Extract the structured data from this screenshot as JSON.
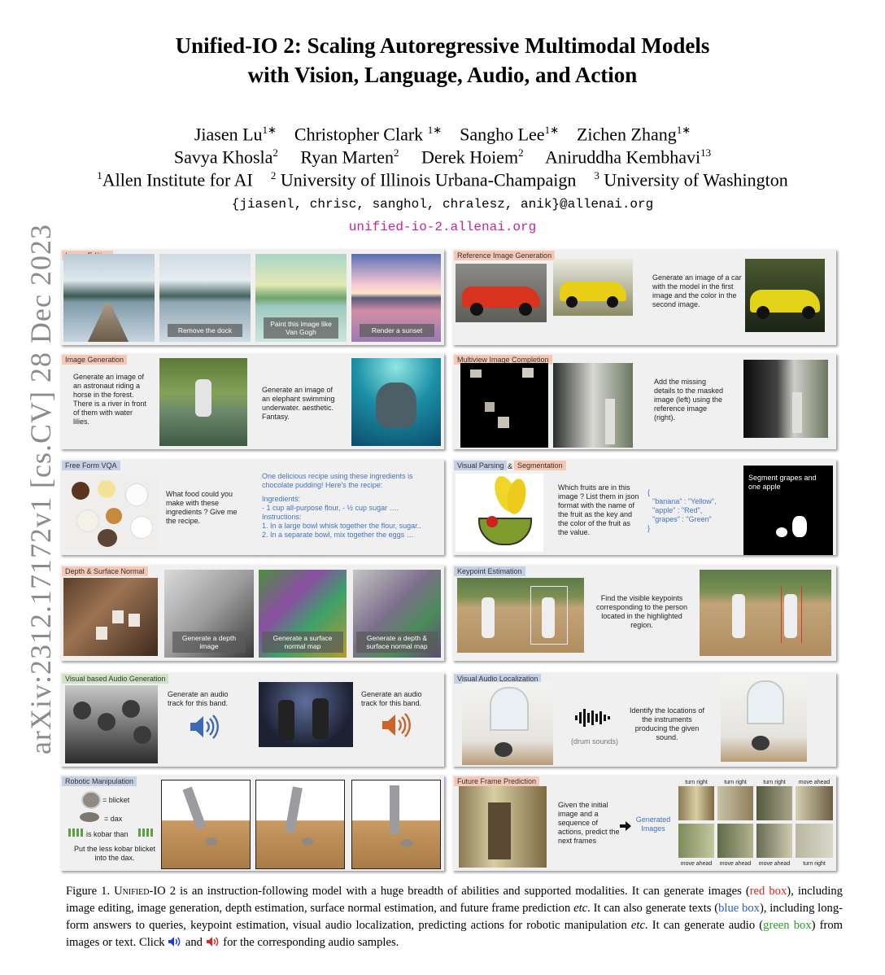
{
  "sidebar_stamp": "arXiv:2312.17172v1  [cs.CV]  28 Dec 2023",
  "title": {
    "line1": "Unified-IO 2: Scaling Autoregressive Multimodal Models",
    "line2": "with Vision, Language, Audio, and Action"
  },
  "authors": {
    "a1": "Jiasen Lu",
    "a2": "Christopher Clark",
    "a3": "Sangho Lee",
    "a4": "Zichen Zhang",
    "a5": "Savya Khosla",
    "a6": "Ryan Marten",
    "a7": "Derek Hoiem",
    "a8": "Aniruddha Kembhavi",
    "m1": "1∗",
    "m2": "1∗",
    "m3": "1∗",
    "m4": "1∗",
    "m5": "2",
    "m6": "2",
    "m7": "2",
    "m8": "13"
  },
  "affiliations": {
    "s1": "1",
    "n1": "Allen Institute for AI",
    "s2": "2",
    "n2": "University of Illinois Urbana-Champaign",
    "s3": "3",
    "n3": "University of Washington"
  },
  "emails": "{jiasenl, chrisc, sanghol, chralesz, anik}@allenai.org",
  "website": "unified-io-2.allenai.org",
  "colors": {
    "website": "#c4269a",
    "red_tag": "#f4c8b4",
    "blue_tag": "#c4d0e6",
    "green_tag": "#cde3c4",
    "blue_text": "#4472c4"
  },
  "panels": {
    "image_editing": {
      "tag": "Image Editing",
      "o1": "Remove the dock",
      "o2": "Paint this image like Van Gogh",
      "o3": "Render a sunset"
    },
    "reference_gen": {
      "tag": "Reference Image Generation",
      "text": "Generate an image of a car with the model in the first image and the color in the second image."
    },
    "image_gen": {
      "tag": "Image Generation",
      "t1": "Generate an image of an astronaut riding a horse in the forest. There is a river in front of them with water lilies.",
      "t2": "Generate an image of an elephant swimming underwater. aesthetic. Fantasy."
    },
    "multiview": {
      "tag": "Multiview Image Completion",
      "text": "Add the missing details to the masked image (left) using the reference image (right)."
    },
    "vqa": {
      "tag": "Free Form VQA",
      "question": "What food could you make with these ingredients ? Give me the recipe.",
      "a1": "One delicious recipe using these ingredients is chocolate pudding! Here's the recipe:",
      "a2": "Ingredients:",
      "a3": "- 1 cup all-purpose flour, - ½ cup sugar ….",
      "a4": "Instructions:",
      "a5": "1. In a large bowl whisk together the flour, sugar..",
      "a6": "2. In a separate bowl, mix together the eggs …"
    },
    "parsing": {
      "tag1": "Visual Parsing",
      "amp": "&",
      "tag2": "Segmentation",
      "question": "Which fruits are in this image ? List them in json format with the name of the fruit as the key and the color of the fruit as the value.",
      "j1": "{",
      "j2": "\"banana\" : \"Yellow\",",
      "j3": "\"apple\" : \"Red\",",
      "j4": "\"grapes\" : \"Green\"",
      "j5": "}",
      "seg": "Segment grapes and one apple"
    },
    "depth": {
      "tag": "Depth & Surface Normal",
      "o1": "Generate a depth image",
      "o2": "Generate a surface normal map",
      "o3": "Generate a depth & surface normal map"
    },
    "keypoint": {
      "tag": "Keypoint Estimation",
      "text": "Find the visible keypoints corresponding to the person located in the highlighted region."
    },
    "audio_gen": {
      "tag": "Visual based Audio Generation",
      "t1": "Generate an audio track for this band.",
      "t2": "Generate an audio track for this band."
    },
    "audio_loc": {
      "tag": "Visual Audio Localization",
      "sounds": "(drum sounds)",
      "text": "Identify the locations of the instruments producing the given sound."
    },
    "robot": {
      "tag": "Robotic Manipulation",
      "l1": "= blicket",
      "l2": "= dax",
      "l3": "is kobar than",
      "instr": "Put the less kobar blicket into the dax."
    },
    "future": {
      "tag": "Future Frame Prediction",
      "text": "Given the initial image and a sequence of actions, predict the next frames",
      "gen": "Generated Images",
      "top": [
        "turn right",
        "turn right",
        "turn right",
        "move ahead"
      ],
      "bottom": [
        "move ahead",
        "move ahead",
        "move ahead",
        "turn right"
      ]
    }
  },
  "caption": {
    "p1": "Figure 1. ",
    "p2": "Unified-IO 2",
    "p3": " is an instruction-following model with a huge breadth of abilities and supported modalities. It can generate images (",
    "red": "red box",
    "p4": "), including image editing, image generation, depth estimation, surface normal estimation, and future frame prediction ",
    "etc1": "etc",
    "p5": ". It can also generate texts (",
    "blue": "blue box",
    "p6": "), including long-form answers to queries, keypoint estimation, visual audio localization, predicting actions for robotic manipulation ",
    "etc2": "etc",
    "p7": ". It can generate audio (",
    "green": "green box",
    "p8": ") from images or text. Click ",
    "and": " and ",
    "p9": " for the corresponding audio samples."
  }
}
